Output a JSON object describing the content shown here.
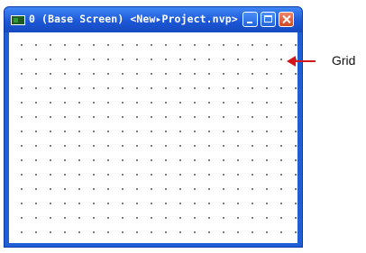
{
  "window": {
    "title": "0 (Base Screen) <New▸Project.nvp>",
    "buttons": {
      "minimize": "minimize",
      "maximize": "maximize",
      "close": "close"
    }
  },
  "canvas": {
    "grid": true,
    "grid_color": "#222222"
  },
  "annotation": {
    "label": "Grid",
    "arrow_color": "#d41616"
  },
  "icons": [
    "app-screen-icon",
    "minimize-icon",
    "maximize-icon",
    "close-icon",
    "arrow-left-icon"
  ]
}
